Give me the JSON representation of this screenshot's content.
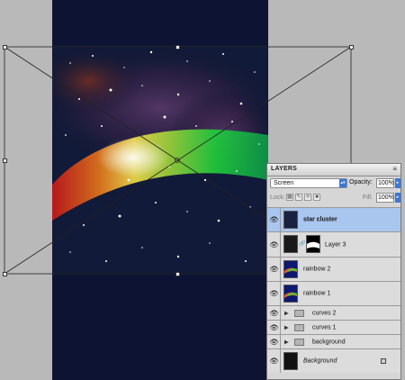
{
  "panel": {
    "tab_label": "LAYERS",
    "menu_icon": "panel-menu-icon",
    "blend_mode": "Screen",
    "opacity_label": "Opacity:",
    "opacity_value": "100%",
    "lock_label": "Lock:",
    "fill_label": "Fill:",
    "fill_value": "100%"
  },
  "layers": [
    {
      "name": "star cluster",
      "selected": true
    },
    {
      "name": "Layer 3",
      "selected": false
    },
    {
      "name": "rainbow 2",
      "selected": false
    },
    {
      "name": "rainbow 1",
      "selected": false
    },
    {
      "name": "curves 2",
      "selected": false
    },
    {
      "name": "curves 1",
      "selected": false
    },
    {
      "name": "background",
      "selected": false
    },
    {
      "name": "Background",
      "selected": false
    }
  ],
  "colors": {
    "selection": "#a9c6ef",
    "accent": "#3b78d8",
    "canvas_bg": "#0d1433"
  }
}
